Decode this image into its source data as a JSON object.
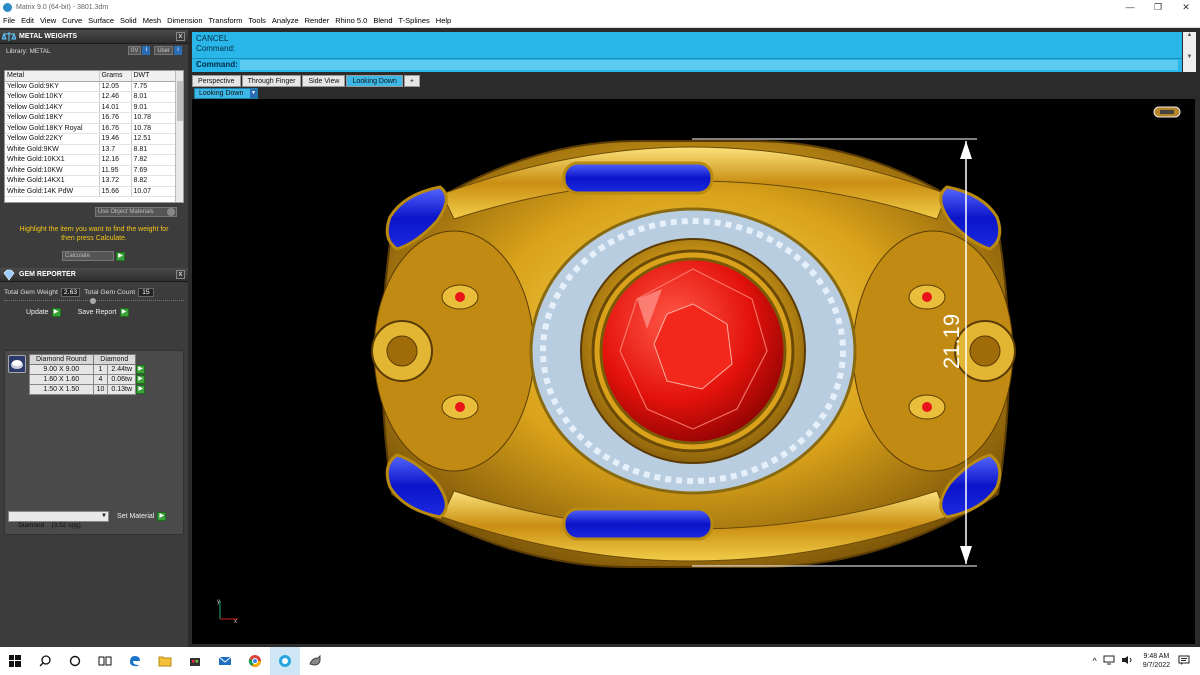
{
  "window": {
    "title": "Matrix 9.0 (64-bit) - 3801.3dm",
    "min": "—",
    "max": "❐",
    "close": "✕"
  },
  "menu": [
    "File",
    "Edit",
    "View",
    "Curve",
    "Surface",
    "Solid",
    "Mesh",
    "Dimension",
    "Transform",
    "Tools",
    "Analyze",
    "Render",
    "Rhino 5.0",
    "Blend",
    "T-Splines",
    "Help"
  ],
  "metal_weights": {
    "header": "METAL WEIGHTS",
    "library_label": "Library: METAL",
    "btn1": "0V",
    "btn2": "User",
    "columns": [
      "Metal",
      "Grams",
      "DWT"
    ],
    "rows": [
      [
        "Yellow Gold:9KY",
        "12.05",
        "7.75"
      ],
      [
        "Yellow Gold:10KY",
        "12.46",
        "8.01"
      ],
      [
        "Yellow Gold:14KY",
        "14.01",
        "9.01"
      ],
      [
        "Yellow Gold:18KY",
        "16.76",
        "10.78"
      ],
      [
        "Yellow Gold:18KY Royal",
        "16.76",
        "10.78"
      ],
      [
        "Yellow Gold:22KY",
        "19.46",
        "12.51"
      ],
      [
        "White Gold:9KW",
        "13.7",
        "8.81"
      ],
      [
        "White Gold:10KX1",
        "12.16",
        "7.82"
      ],
      [
        "White Gold:10KW",
        "11.95",
        "7.69"
      ],
      [
        "White Gold:14KX1",
        "13.72",
        "8.82"
      ],
      [
        "White Gold:14K PdW",
        "15.66",
        "10.07"
      ]
    ],
    "use_object_materials": "Use Object Materials",
    "hint": "Highlight the item you want to find the weight for then press Calculate.",
    "calculate": "Calculate"
  },
  "gem_reporter": {
    "header": "GEM REPORTER",
    "total_weight_label": "Total Gem Weight",
    "total_weight": "2.63",
    "total_count_label": "Total Gem Count",
    "total_count": "15",
    "update": "Update",
    "save_report": "Save Report",
    "columns": [
      "Diamond Round",
      "Diamond"
    ],
    "rows": [
      [
        "9.00 X 9.00",
        "1",
        "2.44tw"
      ],
      [
        "1.60 X 1.60",
        "4",
        "0.06tw"
      ],
      [
        "1.50 X 1.50",
        "10",
        "0.13tw"
      ]
    ],
    "material_select": "Diamond    (3.52 spg)",
    "set_material": "Set Material"
  },
  "command": {
    "line1": "CANCEL",
    "line2": "Command:",
    "prompt": "Command:"
  },
  "tabs": [
    "Perspective",
    "Through Finger",
    "Side View",
    "Looking Down",
    "+"
  ],
  "active_tab": 3,
  "view_dropdown": "Looking Down",
  "dimension_value": "21.19",
  "taskbar": {
    "time": "9:48 AM",
    "date": "9/7/2022"
  }
}
